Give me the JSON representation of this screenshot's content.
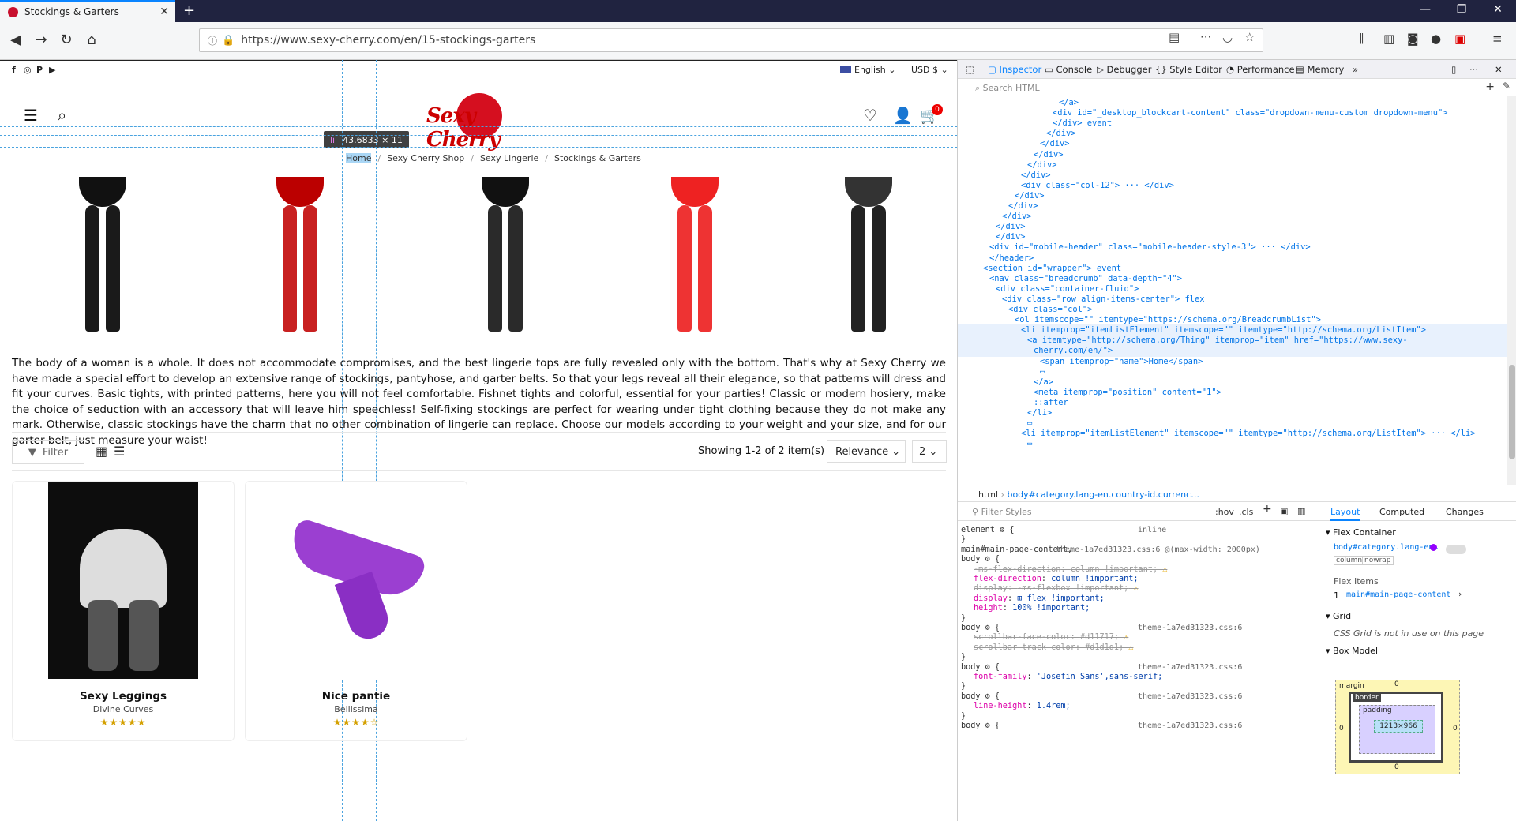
{
  "browser": {
    "tab_title": "Stockings & Garters",
    "url": "https://www.sexy-cherry.com/en/15-stockings-garters",
    "close_glyph": "✕",
    "new_tab_glyph": "+"
  },
  "page": {
    "language": "English",
    "currency": "USD $",
    "logo_text": "Sexy Cherry",
    "cart_count": "0",
    "breadcrumb": [
      "Home",
      "Sexy Cherry Shop",
      "Sexy Lingerie",
      "Stockings & Garters"
    ],
    "breadcrumb_sep": "/",
    "description": "The body of a woman is a whole. It does not accommodate compromises, and the best lingerie tops are fully revealed only with the bottom. That's why at Sexy Cherry we have made a special effort to develop an extensive range of stockings, pantyhose, and garter belts. So that your legs reveal all their elegance, so that patterns will dress and fit your curves. Basic tights, with printed patterns, here you will not feel comfortable. Fishnet tights and colorful, essential for your parties! Classic or modern hosiery, make the choice of seduction with an accessory that will leave him speechless! Self-fixing stockings are perfect for wearing under tight clothing because they do not make any mark. Otherwise, classic stockings have the charm that no other combination of lingerie can replace. Choose our models according to your weight and your size, and for our garter belt, just measure your waist!",
    "filter_label": "Filter",
    "showing_text": "Showing 1-2 of 2 item(s)",
    "sort_value": "Relevance",
    "per_page_value": "2",
    "tooltip_tag": "li",
    "tooltip_dims": "43.6833 × 11",
    "products": [
      {
        "name": "Sexy Leggings",
        "brand": "Divine Curves",
        "stars": "★★★★★"
      },
      {
        "name": "Nice pantie",
        "brand": "Bellissima",
        "stars": "★★★★☆"
      }
    ],
    "legs": [
      {
        "color": "#1a1a1a",
        "top": "#111"
      },
      {
        "color": "#c82020",
        "top": "#b00"
      },
      {
        "color": "#2a2a2a",
        "top": "#111"
      },
      {
        "color": "#e33",
        "top": "#e22"
      },
      {
        "color": "#222",
        "top": "#333"
      }
    ]
  },
  "devtools": {
    "tabs": [
      "Inspector",
      "Console",
      "Debugger",
      "Style Editor",
      "Performance",
      "Memory"
    ],
    "search_placeholder": "Search HTML",
    "markup": [
      {
        "indent": 22,
        "text": "</a>"
      },
      {
        "indent": 20,
        "text": "<div id=\"_desktop_blockcart-content\" class=\"dropdown-menu-custom dropdown-menu\">"
      },
      {
        "indent": 20,
        "text": "</div> event"
      },
      {
        "indent": 18,
        "text": "</div>"
      },
      {
        "indent": 16,
        "text": "</div>"
      },
      {
        "indent": 14,
        "text": "</div>"
      },
      {
        "indent": 12,
        "text": "</div>"
      },
      {
        "indent": 10,
        "text": "</div>"
      },
      {
        "indent": 10,
        "text": "<div class=\"col-12\"> ··· </div>"
      },
      {
        "indent": 8,
        "text": "</div>"
      },
      {
        "indent": 6,
        "text": "</div>"
      },
      {
        "indent": 4,
        "text": "</div>"
      },
      {
        "indent": 2,
        "text": "</div>"
      },
      {
        "indent": 2,
        "text": "</div>"
      },
      {
        "indent": 0,
        "text": "<div id=\"mobile-header\" class=\"mobile-header-style-3\"> ··· </div>"
      },
      {
        "indent": 0,
        "text": "</header>"
      },
      {
        "indent": -2,
        "text": "<section id=\"wrapper\"> event"
      },
      {
        "indent": 0,
        "text": "<nav class=\"breadcrumb\" data-depth=\"4\">"
      },
      {
        "indent": 2,
        "text": "<div class=\"container-fluid\">"
      },
      {
        "indent": 4,
        "text": "<div class=\"row align-items-center\"> flex"
      },
      {
        "indent": 6,
        "text": "<div class=\"col\">"
      },
      {
        "indent": 8,
        "text": "<ol itemscope=\"\" itemtype=\"https://schema.org/BreadcrumbList\">"
      },
      {
        "indent": 10,
        "text": "<li itemprop=\"itemListElement\" itemscope=\"\" itemtype=\"http://schema.org/ListItem\">"
      },
      {
        "indent": 12,
        "text": "<a itemtype=\"http://schema.org/Thing\" itemprop=\"item\" href=\"https://www.sexy-"
      },
      {
        "indent": 14,
        "text": "cherry.com/en/\">"
      },
      {
        "indent": 16,
        "text": "<span itemprop=\"name\">Home</span>"
      },
      {
        "indent": 16,
        "text": "▭"
      },
      {
        "indent": 14,
        "text": "</a>"
      },
      {
        "indent": 14,
        "text": "<meta itemprop=\"position\" content=\"1\">"
      },
      {
        "indent": 14,
        "text": "::after"
      },
      {
        "indent": 12,
        "text": "</li>"
      },
      {
        "indent": 12,
        "text": "▭"
      },
      {
        "indent": 10,
        "text": "<li itemprop=\"itemListElement\" itemscope=\"\" itemtype=\"http://schema.org/ListItem\"> ··· </li>"
      },
      {
        "indent": 12,
        "text": "▭"
      }
    ],
    "breadcrumb_html": "html",
    "breadcrumb_sel": "body#category.lang-en.country-id.currenc…",
    "filter_styles": "Filter Styles",
    "hov": ":hov",
    "cls": ".cls",
    "rules": [
      {
        "t": "sel",
        "text": "element ⚙ {",
        "src": "inline"
      },
      {
        "t": "close",
        "text": "}"
      },
      {
        "t": "sel",
        "text": "main#main-page-content,",
        "src": "theme-1a7ed31323.css:6 @(max-width: 2000px)"
      },
      {
        "t": "sel",
        "text": "body ⚙ {"
      },
      {
        "t": "strike",
        "p": "-ms-flex-direction",
        "v": "column !important;",
        "warn": true
      },
      {
        "t": "prop",
        "p": "flex-direction",
        "v": "column !important;"
      },
      {
        "t": "strike",
        "p": "display",
        "v": "-ms-flexbox !important;",
        "warn": true
      },
      {
        "t": "prop",
        "p": "display",
        "v": "⊞ flex !important;"
      },
      {
        "t": "prop",
        "p": "height",
        "v": "100% !important;"
      },
      {
        "t": "close",
        "text": "}"
      },
      {
        "t": "sel",
        "text": "body ⚙ {",
        "src": "theme-1a7ed31323.css:6"
      },
      {
        "t": "strike",
        "p": "scrollbar-face-color",
        "v": "#d11717;",
        "warn": true
      },
      {
        "t": "strike",
        "p": "scrollbar-track-color",
        "v": "#d1d1d1;",
        "warn": true
      },
      {
        "t": "close",
        "text": "}"
      },
      {
        "t": "sel",
        "text": "body ⚙ {",
        "src": "theme-1a7ed31323.css:6"
      },
      {
        "t": "prop",
        "p": "font-family",
        "v": "'Josefin Sans',sans-serif;"
      },
      {
        "t": "close",
        "text": "}"
      },
      {
        "t": "sel",
        "text": "body ⚙ {",
        "src": "theme-1a7ed31323.css:6"
      },
      {
        "t": "prop",
        "p": "line-height",
        "v": "1.4rem;"
      },
      {
        "t": "close",
        "text": "}"
      },
      {
        "t": "sel",
        "text": "body ⚙ {",
        "src": "theme-1a7ed31323.css:6"
      }
    ],
    "layout_tabs": [
      "Layout",
      "Computed",
      "Changes"
    ],
    "flex_container": "Flex Container",
    "flex_selector": "body#category.lang-en…",
    "flex_chip_1": "column",
    "flex_chip_2": "nowrap",
    "flex_items": "Flex Items",
    "flex_item_index": "1",
    "flex_item": "main#main-page-content",
    "grid": "Grid",
    "grid_msg": "CSS Grid is not in use on this page",
    "box_model": "Box Model",
    "bm_margin": "margin",
    "bm_border": "border",
    "bm_padding": "padding",
    "bm_content": "1213×966",
    "bm_zero": "0"
  }
}
